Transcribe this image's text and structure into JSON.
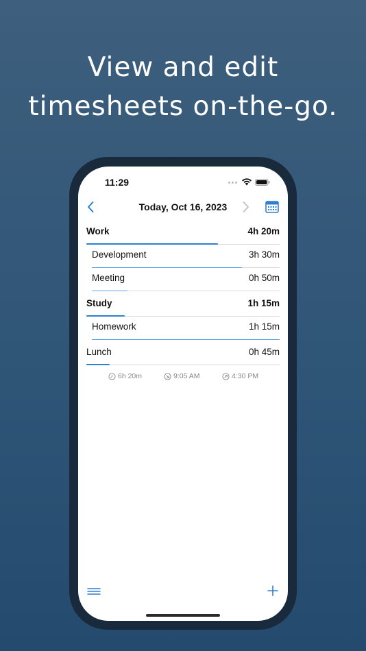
{
  "headline": {
    "line1": "View and edit",
    "line2": "timesheets on-the-go."
  },
  "status_bar": {
    "time": "11:29"
  },
  "nav": {
    "title": "Today, Oct 16, 2023",
    "back_icon": "chevron-left-icon",
    "forward_icon": "chevron-right-icon",
    "calendar_icon": "calendar-icon"
  },
  "entries": [
    {
      "label": "Work",
      "value": "4h 20m",
      "level": "group",
      "progress": 0.68
    },
    {
      "label": "Development",
      "value": "3h 30m",
      "level": "sub",
      "progress": 0.8
    },
    {
      "label": "Meeting",
      "value": "0h 50m",
      "level": "sub",
      "progress": 0.19
    },
    {
      "label": "Study",
      "value": "1h 15m",
      "level": "group",
      "progress": 0.2
    },
    {
      "label": "Homework",
      "value": "1h 15m",
      "level": "sub",
      "progress": 1.0
    },
    {
      "label": "Lunch",
      "value": "0h 45m",
      "level": "group",
      "progress": 0.12
    }
  ],
  "summary": {
    "total": "6h 20m",
    "start": "9:05 AM",
    "end": "4:30 PM"
  },
  "toolbar": {
    "menu_icon": "menu-icon",
    "add_icon": "plus-icon"
  },
  "colors": {
    "accent": "#2f7fd0",
    "sub_accent": "#5aa3e2",
    "background": "#2f5577"
  }
}
